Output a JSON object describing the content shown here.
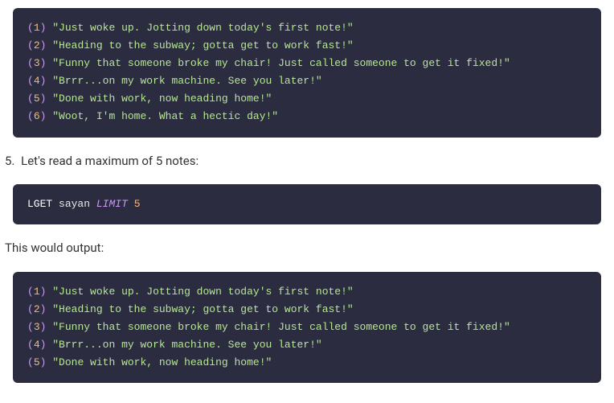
{
  "block1": {
    "lines": [
      {
        "idx": "1",
        "text": "\"Just woke up. Jotting down today's first note!\""
      },
      {
        "idx": "2",
        "text": "\"Heading to the subway; gotta get to work fast!\""
      },
      {
        "idx": "3",
        "text": "\"Funny that someone broke my chair! Just called someone to get it fixed!\""
      },
      {
        "idx": "4",
        "text": "\"Brrr...on my work machine. See you later!\""
      },
      {
        "idx": "5",
        "text": "\"Done with work, now heading home!\""
      },
      {
        "idx": "6",
        "text": "\"Woot, I'm home. What a hectic day!\""
      }
    ]
  },
  "step5": {
    "num": "5.",
    "text": "Let's read a maximum of 5 notes:"
  },
  "command": {
    "lget": "LGET",
    "ident": "sayan",
    "limit": "LIMIT",
    "n": "5"
  },
  "outputLabel": "This would output:",
  "block2": {
    "lines": [
      {
        "idx": "1",
        "text": "\"Just woke up. Jotting down today's first note!\""
      },
      {
        "idx": "2",
        "text": "\"Heading to the subway; gotta get to work fast!\""
      },
      {
        "idx": "3",
        "text": "\"Funny that someone broke my chair! Just called someone to get it fixed!\""
      },
      {
        "idx": "4",
        "text": "\"Brrr...on my work machine. See you later!\""
      },
      {
        "idx": "5",
        "text": "\"Done with work, now heading home!\""
      }
    ]
  }
}
